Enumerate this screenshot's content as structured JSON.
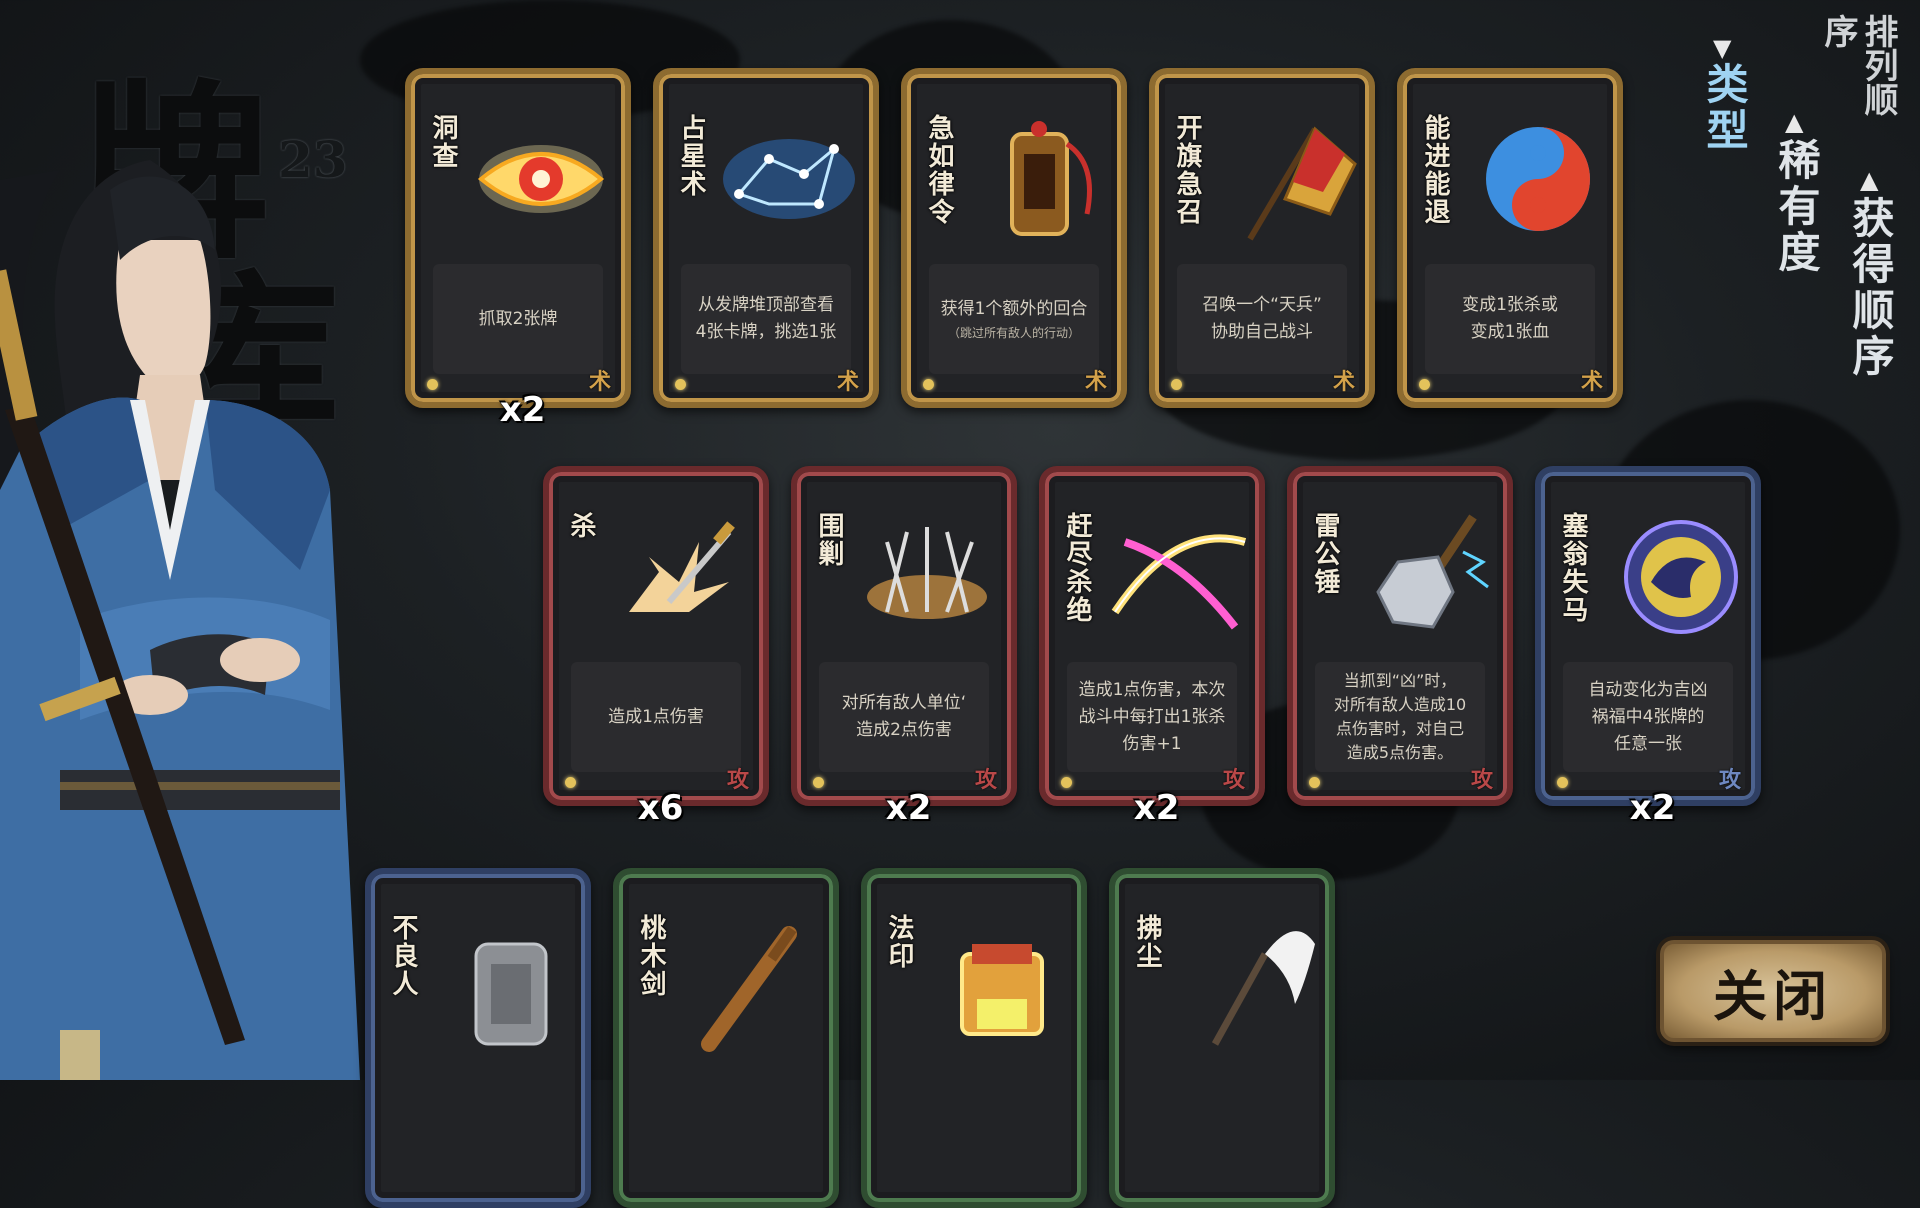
{
  "title": {
    "text": "牌库",
    "count": "23"
  },
  "sort_panel": {
    "label": "排列顺序",
    "options": [
      {
        "label": "类型",
        "active": true,
        "arrow": "▼"
      },
      {
        "label": "稀有度",
        "active": false,
        "arrow": "▲"
      },
      {
        "label": "获得顺序",
        "active": false,
        "arrow": "▲"
      }
    ]
  },
  "colors": {
    "gold": "#8d6b30",
    "red": "#6a2a2c",
    "blue": "#2f3f63",
    "green": "#2f4d31",
    "active_sort": "#9fd3f2",
    "inactive_sort": "#dfe4e8"
  },
  "cards_row1": [
    {
      "name": "洞查",
      "desc": "抓取2张牌",
      "sub": "",
      "count": "x2",
      "icon": "eye-icon",
      "badge": "术"
    },
    {
      "name": "占星术",
      "desc": "从发牌堆顶部查看\n4张卡牌，挑选1张",
      "sub": "",
      "count": "",
      "icon": "constellation-icon",
      "badge": "术"
    },
    {
      "name": "急如律令",
      "desc": "获得1个额外的回合",
      "sub": "（跳过所有敌人的行动）",
      "count": "",
      "icon": "talisman-icon",
      "badge": "术"
    },
    {
      "name": "开旗急召",
      "desc": "召唤一个“天兵”\n协助自己战斗",
      "sub": "",
      "count": "",
      "icon": "banner-icon",
      "badge": "术"
    },
    {
      "name": "能进能退",
      "desc": "变成1张杀或\n变成1张血",
      "sub": "",
      "count": "",
      "icon": "yinyang-icon",
      "badge": "术"
    }
  ],
  "cards_row2": [
    {
      "name": "杀",
      "desc": "造成1点伤害",
      "sub": "",
      "count": "x6",
      "icon": "sword-strike-icon",
      "badge": "攻"
    },
    {
      "name": "围剿",
      "desc": "对所有敌人单位‘\n造成2点伤害",
      "sub": "",
      "count": "x2",
      "icon": "arrows-icon",
      "badge": "攻"
    },
    {
      "name": "赶尽杀绝",
      "desc": "造成1点伤害，本次\n战斗中每打出1张杀\n伤害+1",
      "sub": "",
      "count": "x2",
      "icon": "slash-cross-icon",
      "badge": "攻"
    },
    {
      "name": "雷公锤",
      "desc": "当抓到“凶”时，\n对所有敌人造成10\n点伤害时，对自己\n造成5点伤害。",
      "sub": "",
      "count": "",
      "icon": "hammer-icon",
      "badge": "攻"
    },
    {
      "name": "塞翁失马",
      "desc": "自动变化为吉凶\n祸福中4张牌的\n任意一张",
      "sub": "",
      "count": "x2",
      "icon": "horse-coin-icon",
      "badge": "攻"
    }
  ],
  "cards_row3": [
    {
      "name": "不良人",
      "icon": "token-icon"
    },
    {
      "name": "桃木剑",
      "icon": "wooden-sword-icon"
    },
    {
      "name": "法印",
      "icon": "seal-icon"
    },
    {
      "name": "拂尘",
      "icon": "whisk-icon"
    }
  ],
  "close_button": {
    "label": "关闭"
  }
}
